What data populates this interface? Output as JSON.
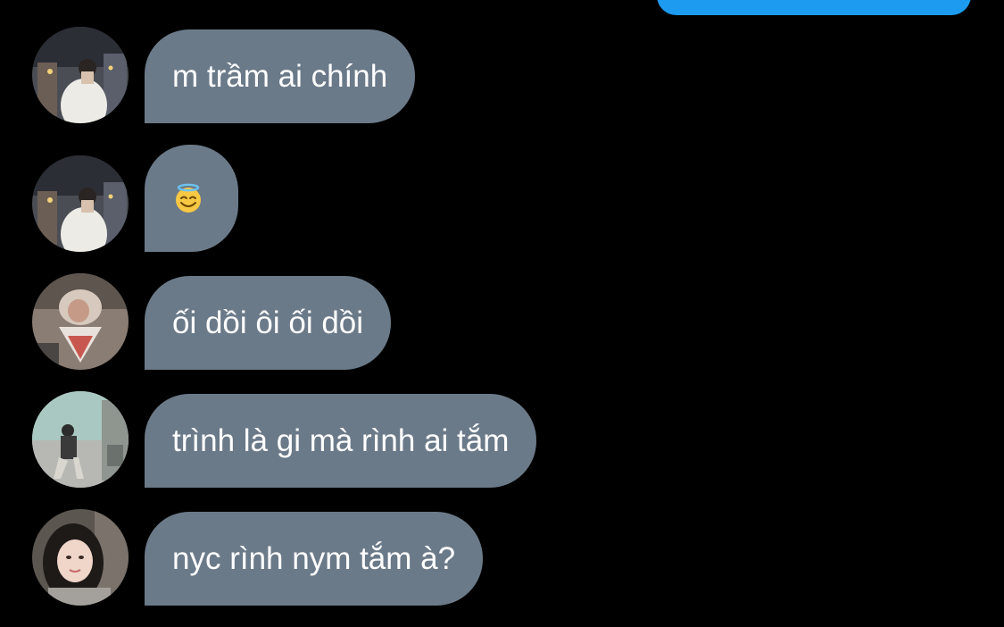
{
  "colors": {
    "background": "#000000",
    "sent_bubble": "#1d9bf0",
    "received_bubble": "#6b7a89",
    "message_text": "#ffffff"
  },
  "messages": [
    {
      "sender_avatar": "avatar-photo-user-1",
      "text": "m trầm ai chính"
    },
    {
      "sender_avatar": "avatar-photo-user-1",
      "emoji": "smiling-face-with-halo-icon"
    },
    {
      "sender_avatar": "avatar-photo-user-2",
      "text": "ối dồi ôi ối dồi"
    },
    {
      "sender_avatar": "avatar-photo-user-3",
      "text": "trình là gi mà rình ai tắm"
    },
    {
      "sender_avatar": "avatar-photo-user-4",
      "text": "nyc rình nym tắm à?"
    }
  ]
}
